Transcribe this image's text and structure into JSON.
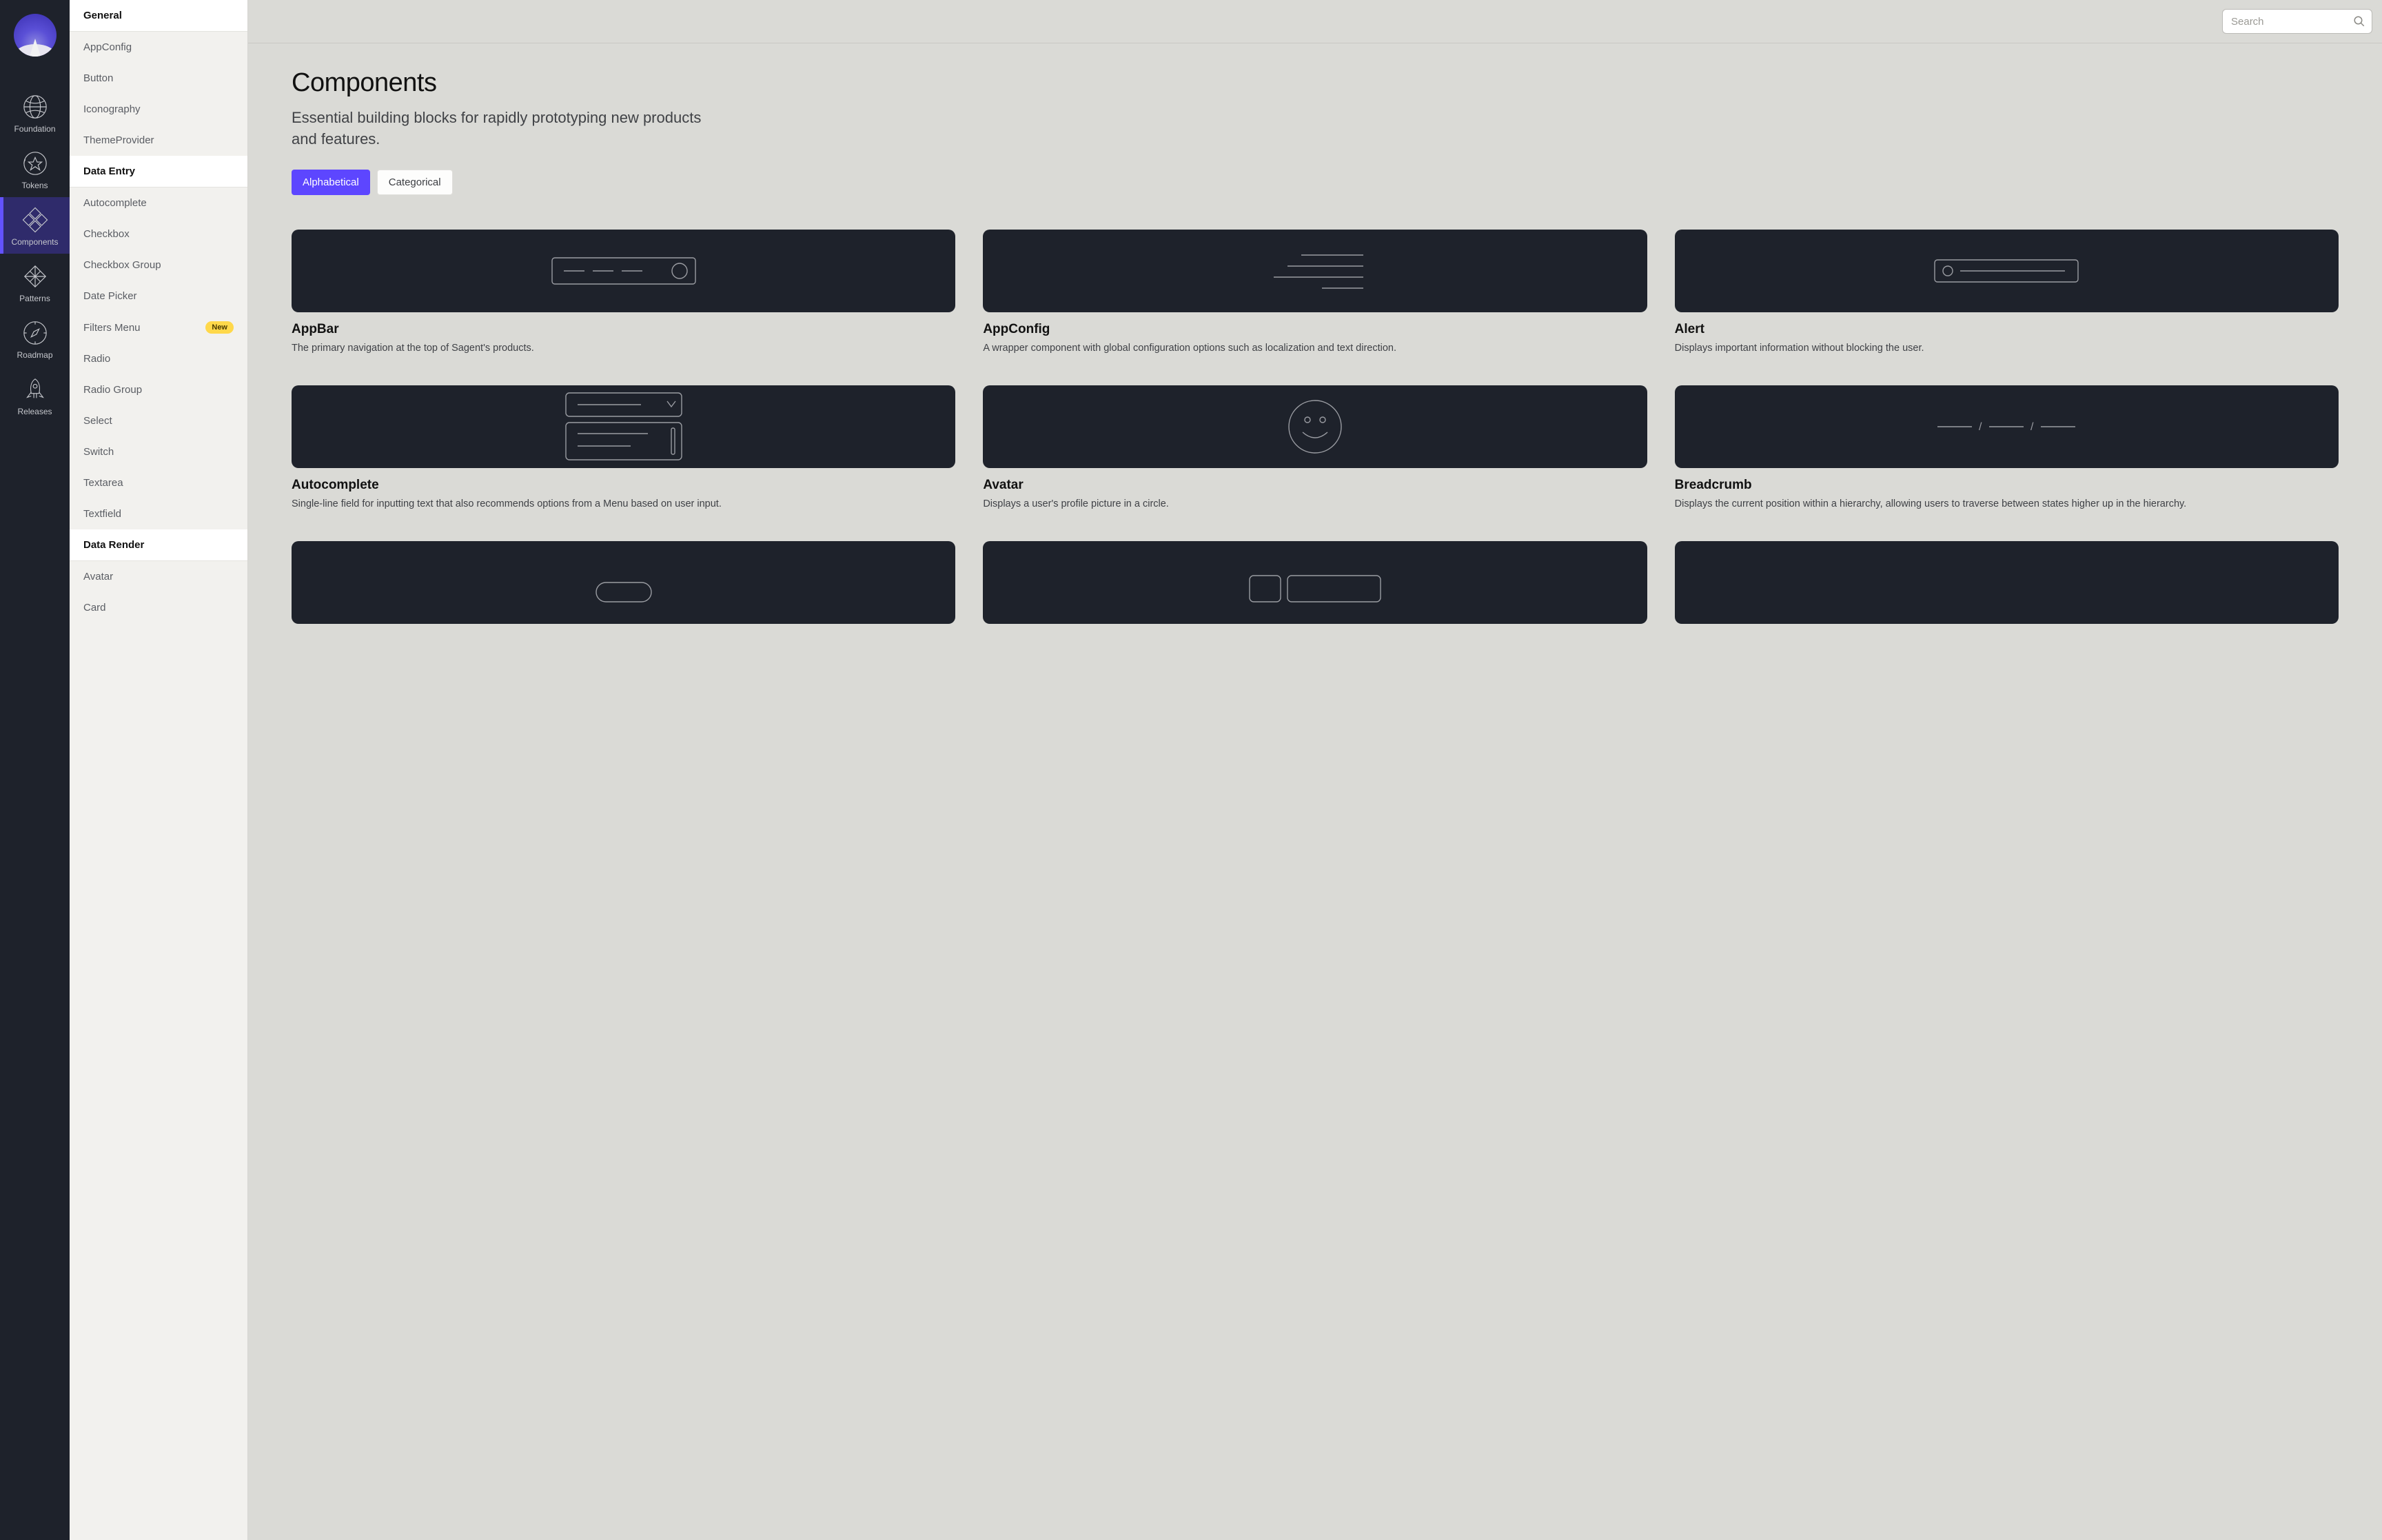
{
  "rail": {
    "items": [
      {
        "label": "Foundation"
      },
      {
        "label": "Tokens"
      },
      {
        "label": "Components"
      },
      {
        "label": "Patterns"
      },
      {
        "label": "Roadmap"
      },
      {
        "label": "Releases"
      }
    ]
  },
  "subnav": {
    "groups": [
      {
        "title": "General",
        "items": [
          {
            "label": "AppConfig"
          },
          {
            "label": "Button"
          },
          {
            "label": "Iconography"
          },
          {
            "label": "ThemeProvider"
          }
        ]
      },
      {
        "title": "Data Entry",
        "items": [
          {
            "label": "Autocomplete"
          },
          {
            "label": "Checkbox"
          },
          {
            "label": "Checkbox Group"
          },
          {
            "label": "Date Picker"
          },
          {
            "label": "Filters Menu",
            "badge": "New"
          },
          {
            "label": "Radio"
          },
          {
            "label": "Radio Group"
          },
          {
            "label": "Select"
          },
          {
            "label": "Switch"
          },
          {
            "label": "Textarea"
          },
          {
            "label": "Textfield"
          }
        ]
      },
      {
        "title": "Data Render",
        "items": [
          {
            "label": "Avatar"
          },
          {
            "label": "Card"
          }
        ]
      }
    ]
  },
  "search": {
    "placeholder": "Search"
  },
  "page": {
    "title": "Components",
    "subtitle": "Essential building blocks for rapidly prototyping new products and features."
  },
  "toggle": {
    "alphabetical": "Alphabetical",
    "categorical": "Categorical"
  },
  "cards": [
    {
      "title": "AppBar",
      "desc": "The primary navigation at the top of Sagent's products."
    },
    {
      "title": "AppConfig",
      "desc": "A wrapper component with global configuration options such as localization and text direction."
    },
    {
      "title": "Alert",
      "desc": "Displays important information without blocking the user."
    },
    {
      "title": "Autocomplete",
      "desc": "Single-line field for inputting text that also recommends options from a Menu based on user input."
    },
    {
      "title": "Avatar",
      "desc": "Displays a user's profile picture in a circle."
    },
    {
      "title": "Breadcrumb",
      "desc": "Displays the current position within a hierarchy, allowing users to traverse between states higher up in the hierarchy."
    },
    {
      "title": "",
      "desc": ""
    },
    {
      "title": "",
      "desc": ""
    },
    {
      "title": "",
      "desc": ""
    }
  ]
}
